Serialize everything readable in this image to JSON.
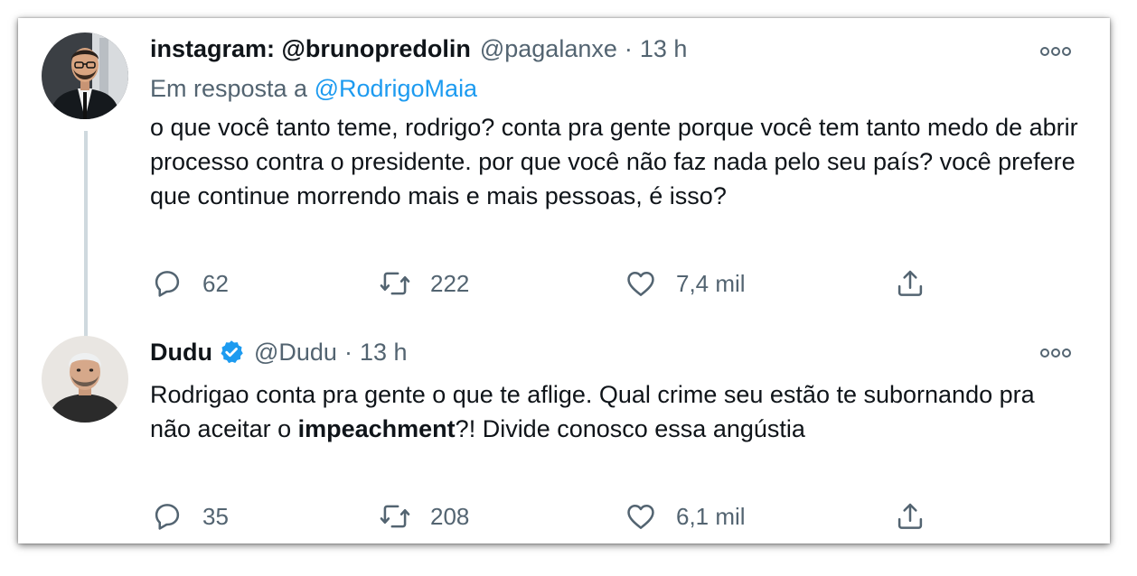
{
  "tweets": [
    {
      "display_name": "instagram: @brunopredolin",
      "handle": "@pagalanxe",
      "separator": "·",
      "time": "13 h",
      "reply_prefix": "Em resposta a",
      "reply_mention": "@RodrigoMaia",
      "text": "o que você tanto teme, rodrigo? conta pra gente porque você tem tanto medo de abrir processo contra o presidente. por que você não faz nada pelo seu país? você prefere que continue morrendo mais e mais pessoas, é isso?",
      "replies": "62",
      "retweets": "222",
      "likes": "7,4 mil"
    },
    {
      "display_name": "Dudu",
      "verified": true,
      "handle": "@Dudu",
      "separator": "·",
      "time": "13 h",
      "text_before": "Rodrigao conta pra gente o que te aflige. Qual crime seu estão te subornando pra não aceitar o ",
      "text_bold": "impeachment",
      "text_after": "?! Divide conosco essa angústia",
      "replies": "35",
      "retweets": "208",
      "likes": "6,1 mil"
    }
  ],
  "colors": {
    "text": "#0f1419",
    "secondary": "#536471",
    "link": "#1d9bf0",
    "thread_line": "#cfd9de"
  },
  "icons": [
    "reply-icon",
    "retweet-icon",
    "like-icon",
    "share-icon",
    "more-icon",
    "verified-badge-icon"
  ]
}
